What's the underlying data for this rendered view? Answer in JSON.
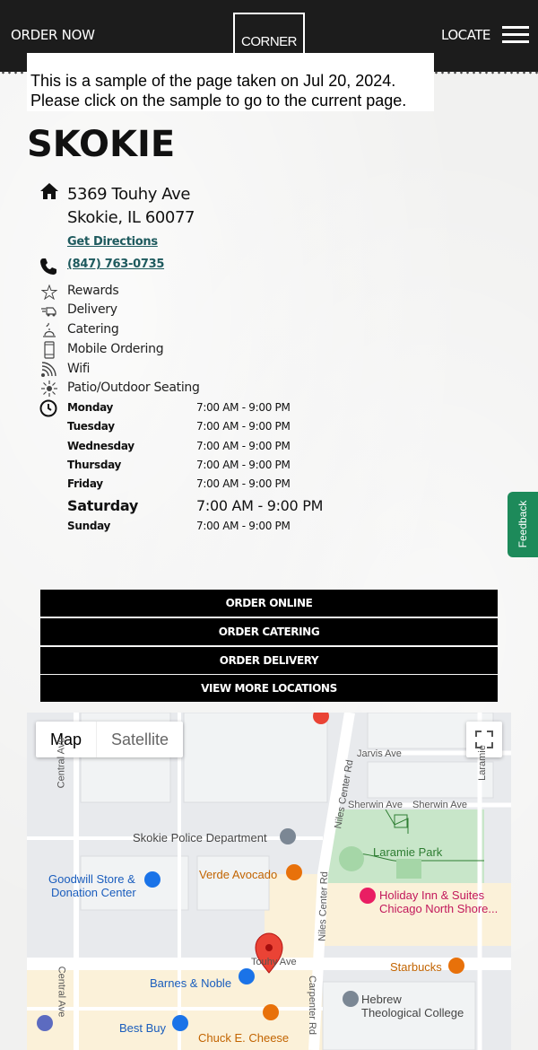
{
  "header": {
    "order_now": "ORDER NOW",
    "logo_text": "CORNER",
    "locate": "LOCATE"
  },
  "notice": {
    "line1": "This is a sample of the page taken on Jul 20, 2024.",
    "line2": "Please click on the sample to go to the current page."
  },
  "location": {
    "city": "SKOKIE",
    "address_line1": "5369 Touhy Ave",
    "address_line2": "Skokie, IL 60077",
    "directions": "Get Directions",
    "phone": "(847) 763-0735"
  },
  "amenities": [
    {
      "label": "Rewards",
      "icon": "star-icon"
    },
    {
      "label": "Delivery",
      "icon": "delivery-icon"
    },
    {
      "label": "Catering",
      "icon": "catering-icon"
    },
    {
      "label": "Mobile Ordering",
      "icon": "mobile-icon"
    },
    {
      "label": "Wifi",
      "icon": "wifi-icon"
    },
    {
      "label": "Patio/Outdoor Seating",
      "icon": "sun-icon"
    }
  ],
  "hours": [
    {
      "day": "Monday",
      "time": "7:00 AM - 9:00 PM"
    },
    {
      "day": "Tuesday",
      "time": "7:00 AM - 9:00 PM"
    },
    {
      "day": "Wednesday",
      "time": "7:00 AM - 9:00 PM"
    },
    {
      "day": "Thursday",
      "time": "7:00 AM - 9:00 PM"
    },
    {
      "day": "Friday",
      "time": "7:00 AM - 9:00 PM"
    },
    {
      "day": "Saturday",
      "time": "7:00 AM - 9:00 PM"
    },
    {
      "day": "Sunday",
      "time": "7:00 AM - 9:00 PM"
    }
  ],
  "feedback": "Feedback",
  "buttons": {
    "order_online": "ORDER ONLINE",
    "order_catering": "ORDER CATERING",
    "order_delivery": "ORDER DELIVERY",
    "view_more": "VIEW MORE LOCATIONS"
  },
  "map": {
    "map_tab": "Map",
    "satellite_tab": "Satellite",
    "places": {
      "police": "Skokie Police Department",
      "laramie_park": "Laramie Park",
      "goodwill_1": "Goodwill Store &",
      "goodwill_2": "Donation Center",
      "verde": "Verde Avocado",
      "holiday_1": "Holiday Inn & Suites",
      "holiday_2": "Chicago North Shore...",
      "starbucks": "Starbucks",
      "barnes": "Barnes & Noble",
      "hebrew_1": "Hebrew",
      "hebrew_2": "Theological College",
      "bestbuy": "Best Buy",
      "chuck": "Chuck E. Cheese"
    },
    "streets": {
      "jarvis": "Jarvis Ave",
      "sherwin1": "Sherwin Ave",
      "sherwin2": "Sherwin Ave",
      "central1": "Central Ave",
      "central2": "Central Ave",
      "niles1": "Niles Center Rd",
      "niles2": "Niles Center Rd",
      "carpenter": "Carpenter Rd",
      "touhy": "Touhy Ave",
      "laramie": "Laramie"
    },
    "colors": {
      "park": "#c8e6c9",
      "road": "#ffffff",
      "pin": "#ea4335",
      "commercial": "#fbf1d9"
    }
  }
}
